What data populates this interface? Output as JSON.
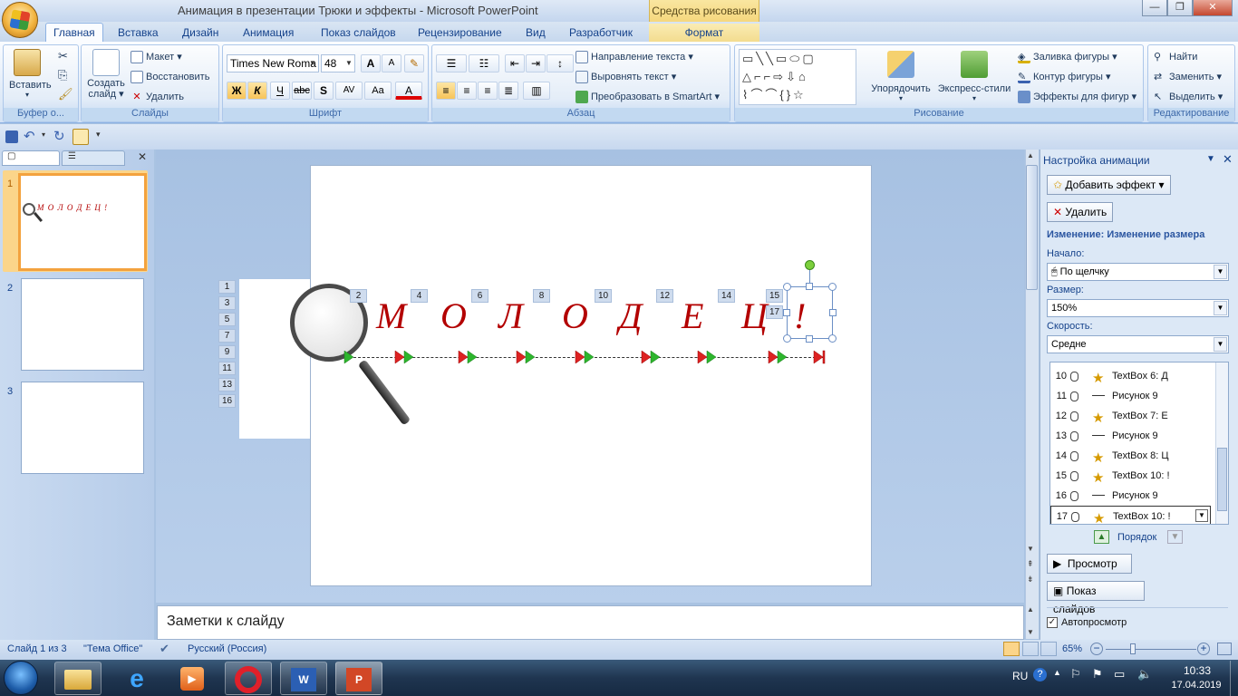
{
  "window": {
    "title": "Анимация в презентации Трюки и эффекты - Microsoft PowerPoint",
    "context_title": "Средства рисования",
    "controls": [
      "minimize",
      "maximize",
      "close"
    ]
  },
  "tabs": [
    "Главная",
    "Вставка",
    "Дизайн",
    "Анимация",
    "Показ слайдов",
    "Рецензирование",
    "Вид",
    "Разработчик",
    "Формат"
  ],
  "active_tab": "Главная",
  "ribbon": {
    "clipboard": {
      "label": "Буфер о...",
      "paste": "Вставить"
    },
    "slides": {
      "label": "Слайды",
      "new_slide": "Создать слайд",
      "layout": "Макет",
      "reset": "Восстановить",
      "delete": "Удалить"
    },
    "font": {
      "label": "Шрифт",
      "font_name": "Times New Roma",
      "font_size": "48",
      "bold": "Ж",
      "italic": "К",
      "underline": "Ч",
      "strike": "abc",
      "shadow": "S",
      "spacing": "AV",
      "case": "Aa",
      "color": "A",
      "grow": "A",
      "shrink": "A"
    },
    "paragraph": {
      "label": "Абзац",
      "text_direction": "Направление текста",
      "align_text": "Выровнять текст",
      "smartart": "Преобразовать в SmartArt"
    },
    "drawing": {
      "label": "Рисование",
      "arrange": "Упорядочить",
      "quick_styles": "Экспресс-стили",
      "fill": "Заливка фигуры",
      "outline": "Контур фигуры",
      "effects": "Эффекты для фигур"
    },
    "editing": {
      "label": "Редактирование",
      "find": "Найти",
      "replace": "Заменить",
      "select": "Выделить"
    }
  },
  "slides_pane": {
    "numbers": [
      "1",
      "2",
      "3"
    ],
    "thumb1_text": "М О Л О Д Е Ц !"
  },
  "slide": {
    "letters": [
      "М",
      "О",
      "Л",
      "О",
      "Д",
      "Е",
      "Ц",
      "!"
    ],
    "left_tags": [
      "1",
      "3",
      "5",
      "7",
      "9",
      "11",
      "13",
      "16"
    ],
    "top_tags": [
      "2",
      "4",
      "6",
      "8",
      "10",
      "12",
      "14",
      "15",
      "17"
    ]
  },
  "notes": {
    "placeholder": "Заметки к слайду"
  },
  "task_pane": {
    "title": "Настройка анимации",
    "add_effect": "Добавить эффект",
    "remove": "Удалить",
    "effect_heading": "Изменение: Изменение размера",
    "start_label": "Начало:",
    "start_value": "По щелчку",
    "size_label": "Размер:",
    "size_value": "150%",
    "speed_label": "Скорость:",
    "speed_value": "Средне",
    "list": [
      {
        "n": "10",
        "kind": "effect",
        "text": "TextBox 6: Д"
      },
      {
        "n": "11",
        "kind": "path",
        "text": "Рисунок 9"
      },
      {
        "n": "12",
        "kind": "effect",
        "text": "TextBox 7: Е"
      },
      {
        "n": "13",
        "kind": "path",
        "text": "Рисунок 9"
      },
      {
        "n": "14",
        "kind": "effect",
        "text": "TextBox 8: Ц"
      },
      {
        "n": "15",
        "kind": "effect",
        "text": "TextBox 10: !"
      },
      {
        "n": "16",
        "kind": "path",
        "text": "Рисунок 9"
      },
      {
        "n": "17",
        "kind": "effect",
        "text": "TextBox 10: !"
      }
    ],
    "order_label": "Порядок",
    "preview": "Просмотр",
    "slideshow": "Показ слайдов",
    "autopreview": "Автопросмотр"
  },
  "status": {
    "slide": "Слайд 1 из 3",
    "theme": "\"Тема Office\"",
    "language": "Русский (Россия)",
    "zoom": "65%"
  },
  "taskbar": {
    "lang": "RU",
    "time": "10:33",
    "date": "17.04.2019"
  },
  "colors": {
    "accent": "#15428b",
    "letters": "#b30000",
    "selection": "#f3a23e"
  }
}
